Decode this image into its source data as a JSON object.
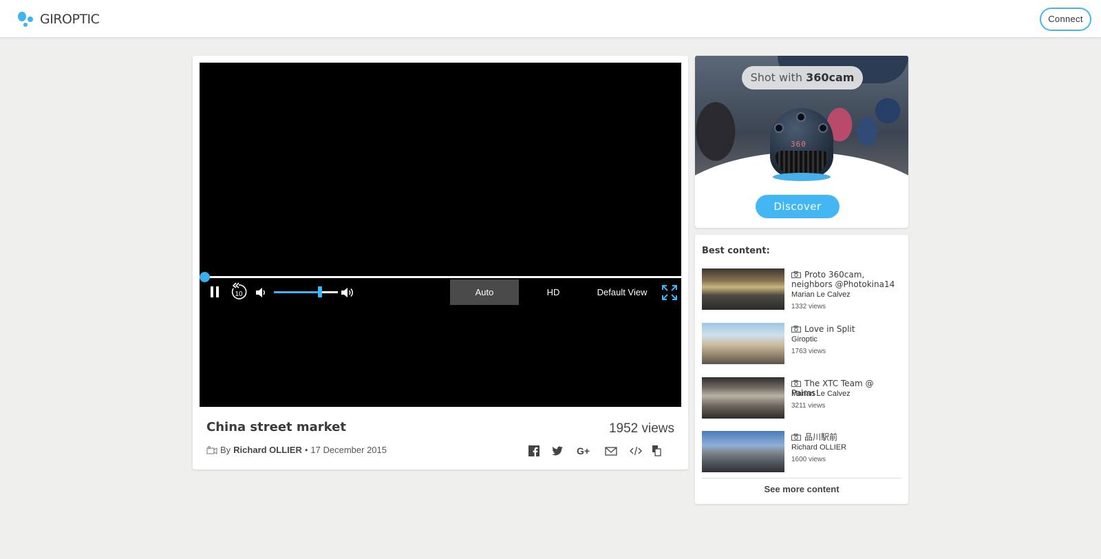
{
  "header": {
    "logo_text": "GIROPTIC",
    "connect_label": "Connect"
  },
  "player": {
    "progress": 0,
    "volume_level": 0.72,
    "rewind_label": "10",
    "quality_auto": "Auto",
    "quality_hd": "HD",
    "view_mode": "Default View"
  },
  "video": {
    "title": "China street market",
    "views": "1952 views",
    "by_prefix": "By",
    "author": "Richard OLLIER",
    "separator": "•",
    "date": "17 December 2015"
  },
  "share_icons": [
    "facebook-icon",
    "twitter-icon",
    "google-plus-icon",
    "email-icon",
    "embed-icon",
    "copy-icon"
  ],
  "ad": {
    "shot_with_prefix": "Shot with",
    "shot_with_brand": "360cam",
    "camera_label": "360",
    "discover_label": "Discover"
  },
  "best_content": {
    "title": "Best content:",
    "items": [
      {
        "title": "Proto 360cam, neighbors @Photokina14",
        "author": "Marian Le Calvez",
        "views": "1332 views"
      },
      {
        "title": "Love in Split",
        "author": "Giroptic",
        "views": "1763 views"
      },
      {
        "title": "The XTC Team @ Palms!",
        "author": "Marian Le Calvez",
        "views": "3211 views"
      },
      {
        "title": "品川駅前",
        "author": "Richard OLLIER",
        "views": "1600 views"
      }
    ],
    "see_more": "See more content"
  },
  "colors": {
    "accent": "#3fb4f0",
    "background": "#efefed",
    "player_bg": "#000000"
  }
}
